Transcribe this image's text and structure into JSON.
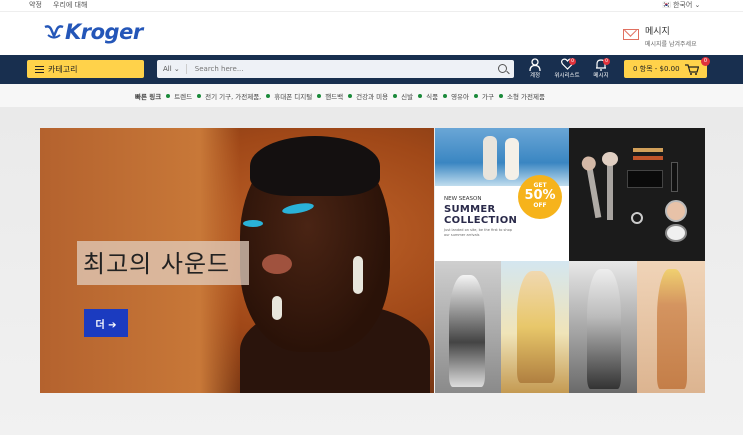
{
  "topbar": {
    "link1": "약정",
    "link2": "우리에 대해",
    "language": "🇰🇷 한국어 ⌄"
  },
  "header": {
    "logo": "Kroger",
    "message_title": "메시지",
    "message_sub": "메시지를 남겨주세요"
  },
  "navbar": {
    "category_label": "카테고리",
    "search_scope": "All ⌄",
    "search_placeholder": "Search here...",
    "icons": [
      {
        "name": "account",
        "label": "계정"
      },
      {
        "name": "wishlist",
        "label": "위시리스트",
        "badge": "0"
      },
      {
        "name": "messages",
        "label": "메시지",
        "badge": "0"
      }
    ],
    "cart_label": "0 항목 - $0.00",
    "cart_badge": "0"
  },
  "quick_links": {
    "title": "빠른 링크",
    "items": [
      "트렌드",
      "전기 기구, 가전제품,",
      "휴대폰 디지털",
      "핸드백",
      "건강과 미용",
      "신발",
      "식품",
      "영유아",
      "가구",
      "소형 가전제품"
    ]
  },
  "hero": {
    "title": "최고의 사운드",
    "button": "더 ➔"
  },
  "tiles": {
    "summer": {
      "new_season": "NEW SEASON",
      "collection_l1": "SUMMER",
      "collection_l2": "COLLECTION",
      "offer_get": "GET",
      "offer_pct": "50%",
      "offer_off": "OFF",
      "small_text": "Just landed on site, be the first to shop our summer arrivals"
    }
  },
  "colors": {
    "nav_bg": "#182f4f",
    "accent_yellow": "#ffd24a",
    "brand_blue": "#2456b8",
    "badge_red": "#e0323b",
    "hero_button": "#1b3bc0"
  }
}
